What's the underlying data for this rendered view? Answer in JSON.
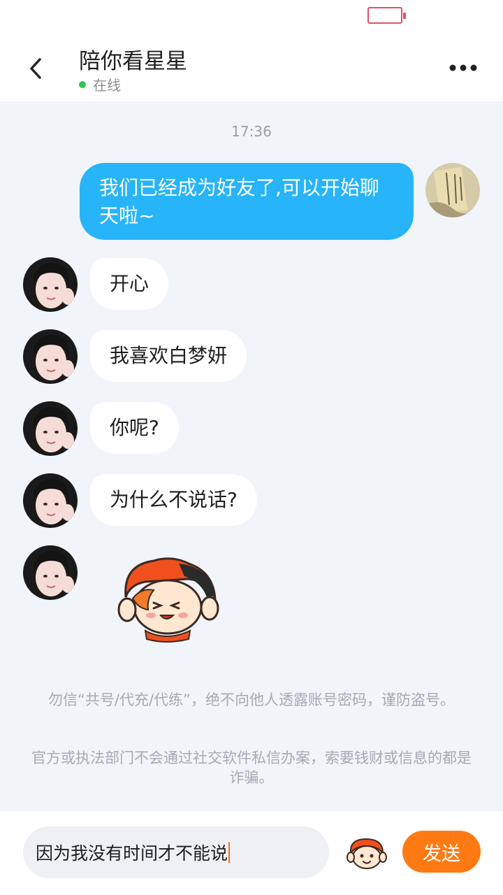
{
  "header": {
    "title": "陪你看星星",
    "status": "在线"
  },
  "chat": {
    "timestamp": "17:36",
    "messages": [
      {
        "from": "self",
        "text": "我们已经成为好友了,可以开始聊天啦~"
      },
      {
        "from": "other",
        "text": "开心"
      },
      {
        "from": "other",
        "text": "我喜欢白梦妍"
      },
      {
        "from": "other",
        "text": "你呢?"
      },
      {
        "from": "other",
        "text": "为什么不说话?"
      },
      {
        "from": "other",
        "type": "sticker",
        "icon": "cartoon-sticker"
      }
    ]
  },
  "notices": [
    "勿信“共号/代充/代练”，绝不向他人透露账号密码，谨防盗号。",
    "官方或执法部门不会通过社交软件私信办案，索要钱财或信息的都是诈骗。"
  ],
  "composer": {
    "input_value": "因为我没有时间才不能说",
    "send_label": "发送"
  },
  "colors": {
    "outgoing_bubble": "#27b4f9",
    "send_button": "#ff7a12",
    "online_dot": "#2dc84d",
    "battery": "#e0506b"
  }
}
